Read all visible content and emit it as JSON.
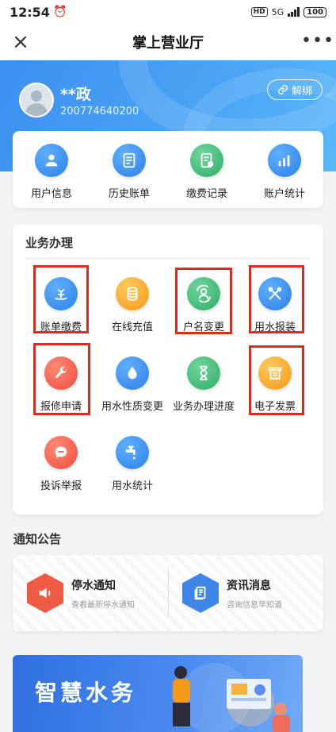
{
  "status_bar": {
    "time": "12:54",
    "hd": "HD",
    "network": "5G",
    "battery": "100"
  },
  "title_bar": {
    "close": "×",
    "title": "掌上营业厅",
    "more": "•••"
  },
  "user": {
    "name": "**政",
    "id": "200774640200",
    "unbind_label": "解绑"
  },
  "quick_actions": [
    {
      "label": "用户信息",
      "icon": "user-icon"
    },
    {
      "label": "历史账单",
      "icon": "bill-icon"
    },
    {
      "label": "缴费记录",
      "icon": "record-icon"
    },
    {
      "label": "账户统计",
      "icon": "stats-icon"
    }
  ],
  "business": {
    "title": "业务办理",
    "items": [
      {
        "label": "账单缴费",
        "icon": "payment-icon",
        "color": "#2d7fe8"
      },
      {
        "label": "在线充值",
        "icon": "coins-icon",
        "color": "#f39a1a"
      },
      {
        "label": "户名变更",
        "icon": "account-change-icon",
        "color": "#2fae6a"
      },
      {
        "label": "用水报装",
        "icon": "tools-icon",
        "color": "#2d7fe8"
      },
      {
        "label": "报修申请",
        "icon": "wrench-icon",
        "color": "#ef4b3b"
      },
      {
        "label": "用水性质变更",
        "icon": "water-drop-icon",
        "color": "#2d7fe8"
      },
      {
        "label": "业务办理进度",
        "icon": "hourglass-icon",
        "color": "#2fae6a"
      },
      {
        "label": "电子发票",
        "icon": "invoice-icon",
        "color": "#f39a1a"
      },
      {
        "label": "投诉举报",
        "icon": "chat-icon",
        "color": "#ef4b3b"
      },
      {
        "label": "用水统计",
        "icon": "faucet-icon",
        "color": "#2d7fe8"
      }
    ]
  },
  "notices": {
    "title": "通知公告",
    "items": [
      {
        "title": "停水通知",
        "subtitle": "查看最新停水通知",
        "icon": "speaker-icon"
      },
      {
        "title": "资讯消息",
        "subtitle": "咨询信息早知道",
        "icon": "document-icon"
      }
    ]
  },
  "banner": {
    "text": "智慧水务"
  },
  "colors": {
    "primary": "#3b8ff0",
    "highlight": "#e02a1a"
  }
}
